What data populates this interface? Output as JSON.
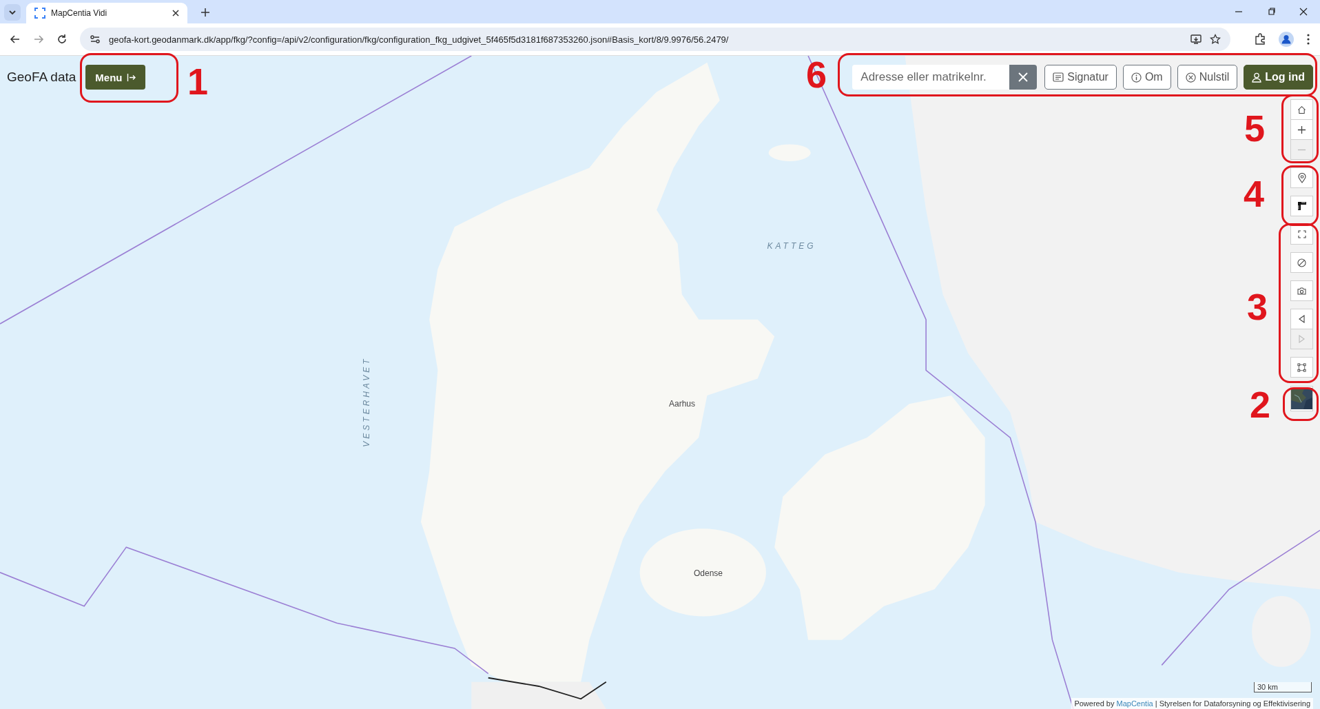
{
  "browser": {
    "tab_title": "MapCentia Vidi",
    "url": "geofa-kort.geodanmark.dk/app/fkg/?config=/api/v2/configuration/fkg/configuration_fkg_udgivet_5f465f5d3181f687353260.json#Basis_kort/8/9.9976/56.2479/"
  },
  "header": {
    "title": "GeoFA data",
    "menu_button": "Menu"
  },
  "toolbar": {
    "search": {
      "placeholder": "Adresse eller matrikelnr."
    },
    "buttons": [
      {
        "kind": "signature",
        "label": "Signatur",
        "primary": false
      },
      {
        "kind": "info",
        "label": "Om",
        "primary": false
      },
      {
        "kind": "reset",
        "label": "Nulstil",
        "primary": false
      },
      {
        "kind": "user",
        "label": "Log ind",
        "primary": true
      }
    ]
  },
  "map_labels": [
    {
      "kind": "sea",
      "label": "VESTERHAVET"
    },
    {
      "kind": "sea",
      "label": "KATTEG"
    },
    {
      "kind": "city",
      "label": "Aarhus"
    },
    {
      "kind": "city",
      "label": "Odense"
    }
  ],
  "map_controls": [
    {
      "items": [
        {
          "kind": "home",
          "disabled": false
        },
        {
          "kind": "zoom-in",
          "disabled": false
        },
        {
          "kind": "zoom-out",
          "disabled": true
        }
      ]
    },
    {
      "items": [
        {
          "kind": "location",
          "disabled": false
        }
      ]
    },
    {
      "items": [
        {
          "kind": "measure",
          "disabled": false
        }
      ]
    },
    {
      "items": [
        {
          "kind": "fullscreen",
          "disabled": false
        }
      ]
    },
    {
      "items": [
        {
          "kind": "clear",
          "disabled": false
        }
      ]
    },
    {
      "items": [
        {
          "kind": "camera",
          "disabled": false
        }
      ]
    },
    {
      "items": [
        {
          "kind": "back",
          "disabled": false
        },
        {
          "kind": "forward",
          "disabled": true
        }
      ]
    },
    {
      "items": [
        {
          "kind": "extent",
          "disabled": false
        }
      ]
    }
  ],
  "scale": "30 km",
  "attribution": {
    "prefix": "Powered by",
    "link": "MapCentia",
    "text": "| Styrelsen for Dataforsyning og Effektivisering"
  },
  "annotations": [
    {
      "label": "1"
    },
    {
      "label": "6"
    },
    {
      "label": "5"
    },
    {
      "label": "4"
    },
    {
      "label": "3"
    },
    {
      "label": "2"
    }
  ]
}
